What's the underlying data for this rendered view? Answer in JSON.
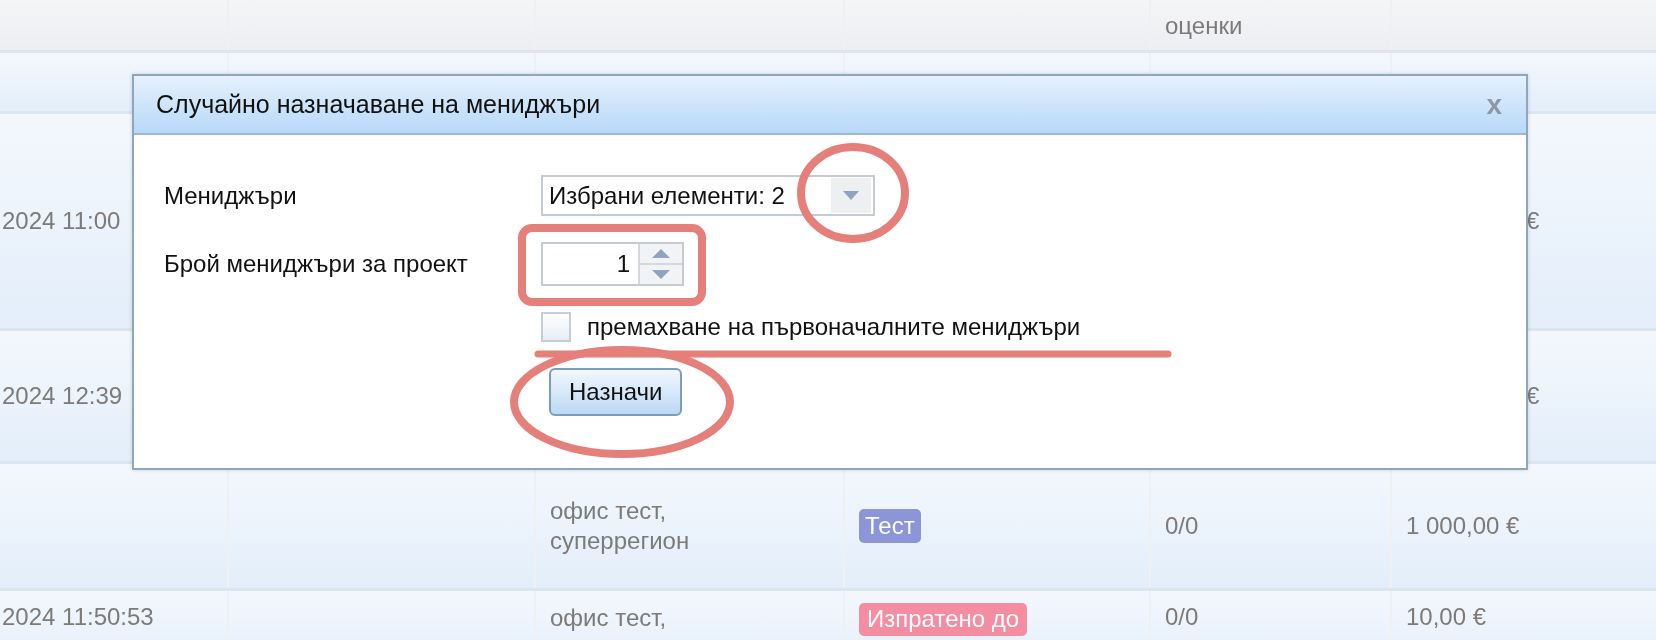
{
  "table": {
    "header": {
      "column_5": "оценки"
    },
    "rows": [
      {
        "column_1": "2024 11:00",
        "column_6": "€"
      },
      {
        "column_1": "2024 12:39",
        "column_6": "€"
      },
      {
        "column_3": "офис тест, суперрегион",
        "column_4": {
          "kind": "badge",
          "text": "Тест",
          "color": "#8c95d8"
        },
        "column_5": "0/0",
        "column_6": "1 000,00 €"
      },
      {
        "column_1": "2024 11:50:53",
        "column_3": "офис тест,",
        "column_4": {
          "kind": "badge",
          "text": "Изпратено до",
          "color": "#f48ca2"
        },
        "column_5": "0/0",
        "column_6": "10,00 €"
      }
    ]
  },
  "dialog": {
    "title": "Случайно назначаване на мениджъри",
    "close": "x",
    "fields": [
      {
        "kind": "multiselect",
        "label": "Мениджъри",
        "value": "Избрани елементи: 2"
      },
      {
        "kind": "spinner",
        "label": "Брой мениджъри за проект",
        "value": "1"
      }
    ],
    "checkbox": {
      "label": "премахване на първоначалните мениджъри",
      "checked": false
    },
    "button": "Назначи"
  },
  "annotations": [
    {
      "kind": "ellipse"
    },
    {
      "kind": "rectangle"
    },
    {
      "kind": "underline"
    },
    {
      "kind": "ellipse"
    }
  ]
}
